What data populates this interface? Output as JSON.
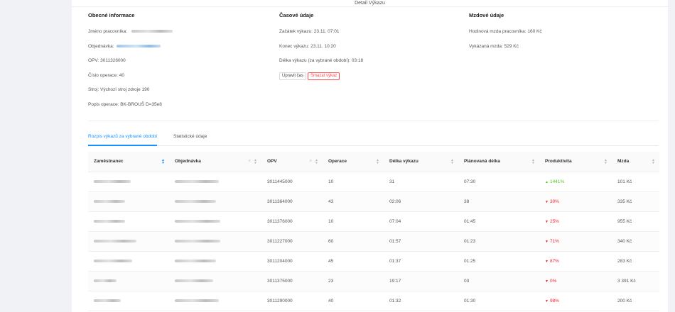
{
  "title": "Detail Výkazu",
  "general": {
    "heading": "Obecné informace",
    "employee_label": "Jméno pracovníka:",
    "order_label": "Objednávka:",
    "opv_label": "OPV:",
    "opv_value": "3011326000",
    "operation_label": "Číslo operace:",
    "operation_value": "40",
    "machine_label": "Stroj:",
    "machine_value": "Výchozí stroj zdroje 190",
    "description_label": "Popis operace:",
    "description_value": "BK-BROUŠ D=35e8"
  },
  "time": {
    "heading": "Časové údaje",
    "start_label": "Začátek výkazu:",
    "start_value": "23.11. 07:01",
    "end_label": "Konec výkazu:",
    "end_value": "23.11. 10:20",
    "length_label": "Délka výkazu (za vybrané období):",
    "length_value": "03:18",
    "edit_button": "Upravit čas",
    "delete_button": "Smazat výkaz"
  },
  "wage": {
    "heading": "Mzdové údaje",
    "hourly_label": "Hodinová mzda pracovníka:",
    "hourly_value": "160 Kč",
    "reported_label": "Vykázaná mzda:",
    "reported_value": "529 Kč"
  },
  "tabs": [
    "Rozpis výkazů za vybrané období",
    "Statistické údaje"
  ],
  "active_tab": 0,
  "columns": [
    "Zaměstnanec",
    "Objednávka",
    "OPV",
    "Operace",
    "Délka výkazu",
    "Plánovaná délka",
    "Produktivita",
    "Mzda"
  ],
  "rows": [
    {
      "opv": "3011445000",
      "operation": "10",
      "length": "31",
      "planned": "07:30",
      "trend": "up",
      "productivity": "1441%",
      "wage": "101 Kč"
    },
    {
      "opv": "3011364000",
      "operation": "43",
      "length": "02:06",
      "planned": "38",
      "trend": "down",
      "productivity": "30%",
      "wage": "335 Kč"
    },
    {
      "opv": "3011376000",
      "operation": "10",
      "length": "07:04",
      "planned": "01:45",
      "trend": "down",
      "productivity": "25%",
      "wage": "955 Kč"
    },
    {
      "opv": "3011227000",
      "operation": "60",
      "length": "01:57",
      "planned": "01:23",
      "trend": "down",
      "productivity": "71%",
      "wage": "340 Kč"
    },
    {
      "opv": "3011204000",
      "operation": "45",
      "length": "01:37",
      "planned": "01:25",
      "trend": "down",
      "productivity": "87%",
      "wage": "283 Kč"
    },
    {
      "opv": "3011375000",
      "operation": "23",
      "length": "19:17",
      "planned": "03",
      "trend": "down",
      "productivity": "0%",
      "wage": "3 391 Kč"
    },
    {
      "opv": "3011290000",
      "operation": "40",
      "length": "01:32",
      "planned": "01:30",
      "trend": "down",
      "productivity": "98%",
      "wage": "200 Kč"
    }
  ],
  "colors": {
    "accent": "#1890ff",
    "up": "#52c41a",
    "down": "#f5222d"
  }
}
